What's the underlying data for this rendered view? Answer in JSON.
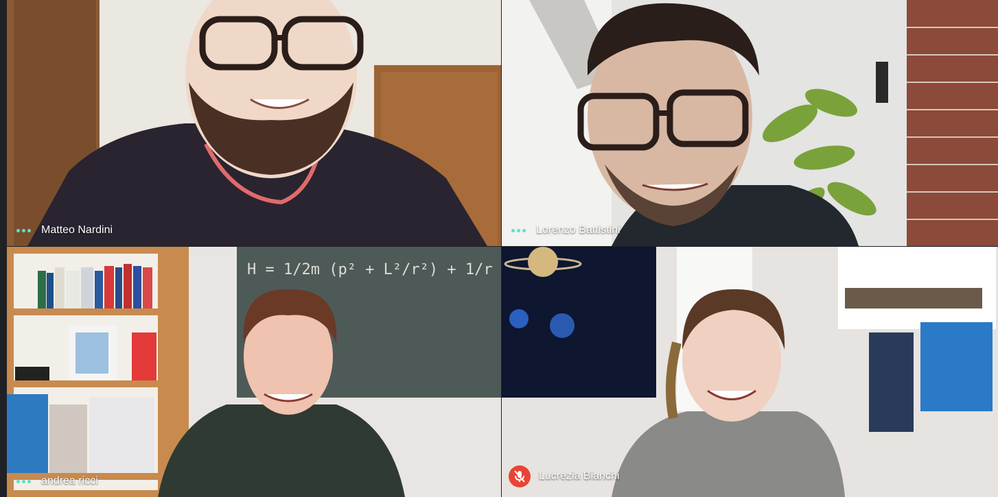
{
  "meeting": {
    "participants": [
      {
        "name": "Matteo Nardini",
        "status_icon": "speaking-dots-icon",
        "muted": false
      },
      {
        "name": "Lorenzo Battistini",
        "status_icon": "speaking-dots-icon",
        "muted": false
      },
      {
        "name": "andrea ricci",
        "status_icon": "speaking-dots-icon",
        "muted": false
      },
      {
        "name": "Lucrezia Bianchi",
        "status_icon": "mic-off-icon",
        "muted": true
      }
    ]
  },
  "colors": {
    "background": "#202124",
    "speaking_dots": "#5ee0c8",
    "muted_badge": "#ea4335",
    "name_text": "#ffffff"
  },
  "chalkboard": {
    "formula": "H = 1/2m (p² + L²/r²) + 1/r"
  }
}
